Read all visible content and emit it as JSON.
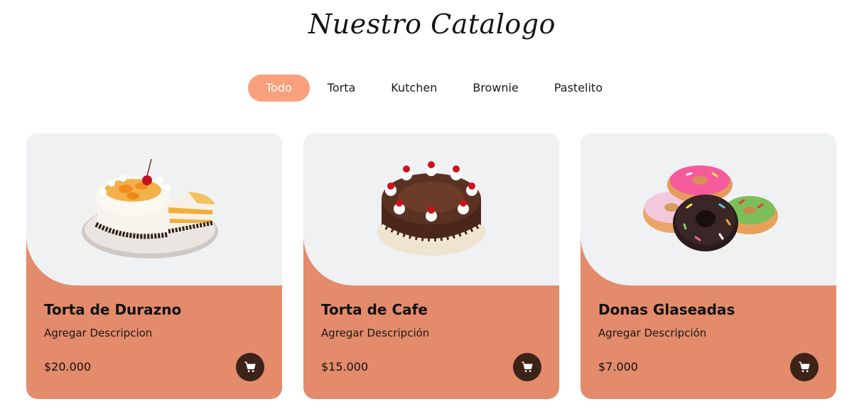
{
  "header": {
    "title": "Nuestro Catalogo"
  },
  "filters": [
    {
      "label": "Todo",
      "active": true
    },
    {
      "label": "Torta",
      "active": false
    },
    {
      "label": "Kutchen",
      "active": false
    },
    {
      "label": "Brownie",
      "active": false
    },
    {
      "label": "Pastelito",
      "active": false
    }
  ],
  "products": [
    {
      "name": "Torta de Durazno",
      "description": "Agregar Descripcion",
      "price": "$20.000",
      "image": "peach-cake-image"
    },
    {
      "name": "Torta de Cafe",
      "description": "Agregar Descripción",
      "price": "$15.000",
      "image": "coffee-cake-image"
    },
    {
      "name": "Donas Glaseadas",
      "description": "Agregar Descripción",
      "price": "$7.000",
      "image": "glazed-donuts-image"
    }
  ],
  "colors": {
    "accent": "#f89f7b",
    "card_background": "#e38b6b",
    "media_background": "#f0f1f3",
    "cart_button": "#3d2218"
  },
  "icons": {
    "cart": "cart-icon"
  }
}
